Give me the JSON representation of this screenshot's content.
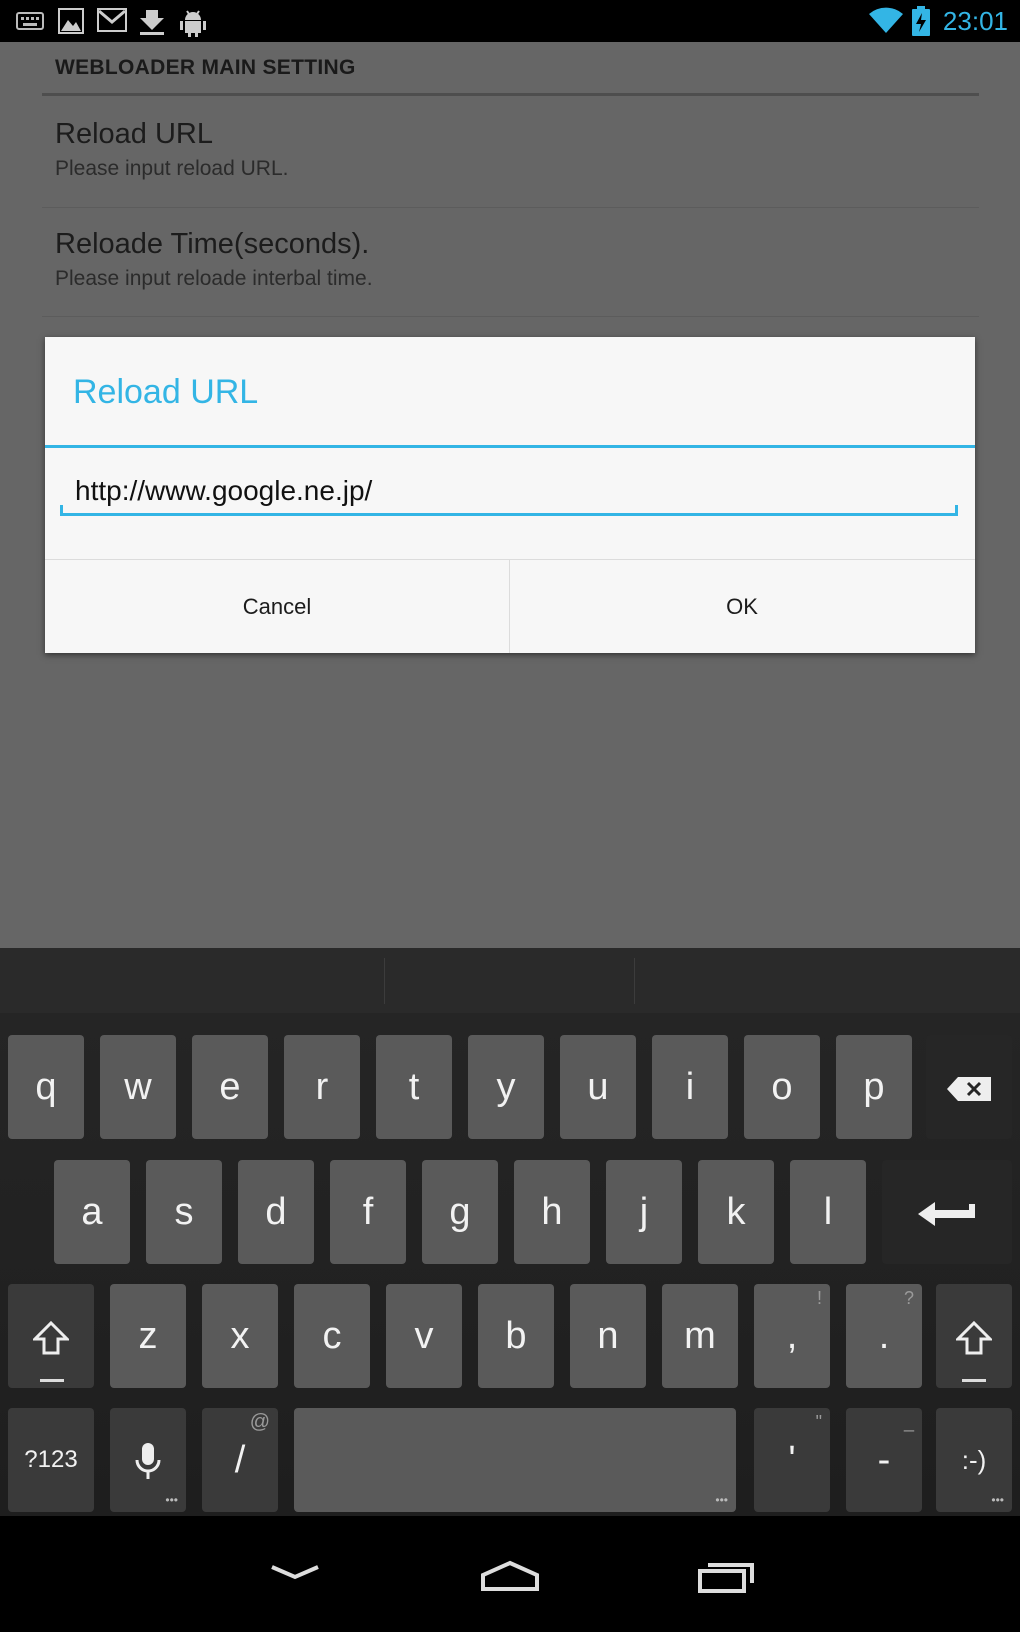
{
  "status_bar": {
    "time": "23:01",
    "accent_color": "#33b5e5",
    "icons": [
      "keyboard-icon",
      "image-icon",
      "gmail-icon",
      "download-icon",
      "android-debug-icon",
      "wifi-icon",
      "battery-charging-icon"
    ]
  },
  "settings": {
    "section_header": "WEBLOADER MAIN SETTING",
    "items": [
      {
        "title": "Reload URL",
        "summary": "Please input reload URL."
      },
      {
        "title": "Reloade Time(seconds).",
        "summary": "Please input reloade interbal time."
      }
    ]
  },
  "dialog": {
    "title": "Reload URL",
    "input_value": "http://www.google.ne.jp/",
    "cancel_label": "Cancel",
    "ok_label": "OK"
  },
  "keyboard": {
    "row1": [
      "q",
      "w",
      "e",
      "r",
      "t",
      "y",
      "u",
      "i",
      "o",
      "p"
    ],
    "row2": [
      "a",
      "s",
      "d",
      "f",
      "g",
      "h",
      "j",
      "k",
      "l"
    ],
    "row3": [
      "z",
      "x",
      "c",
      "v",
      "b",
      "n",
      "m",
      ",",
      "."
    ],
    "row3_hints": {
      "comma": "!",
      "period": "?"
    },
    "symbols_label": "?123",
    "slash_label": "/",
    "slash_hint": "@",
    "apostrophe_label": "'",
    "apostrophe_hint": "\"",
    "dash_label": "-",
    "dash_hint": "_",
    "smiley_label": ":-)"
  },
  "navigation": [
    "back-icon",
    "home-icon",
    "recent-apps-icon"
  ]
}
